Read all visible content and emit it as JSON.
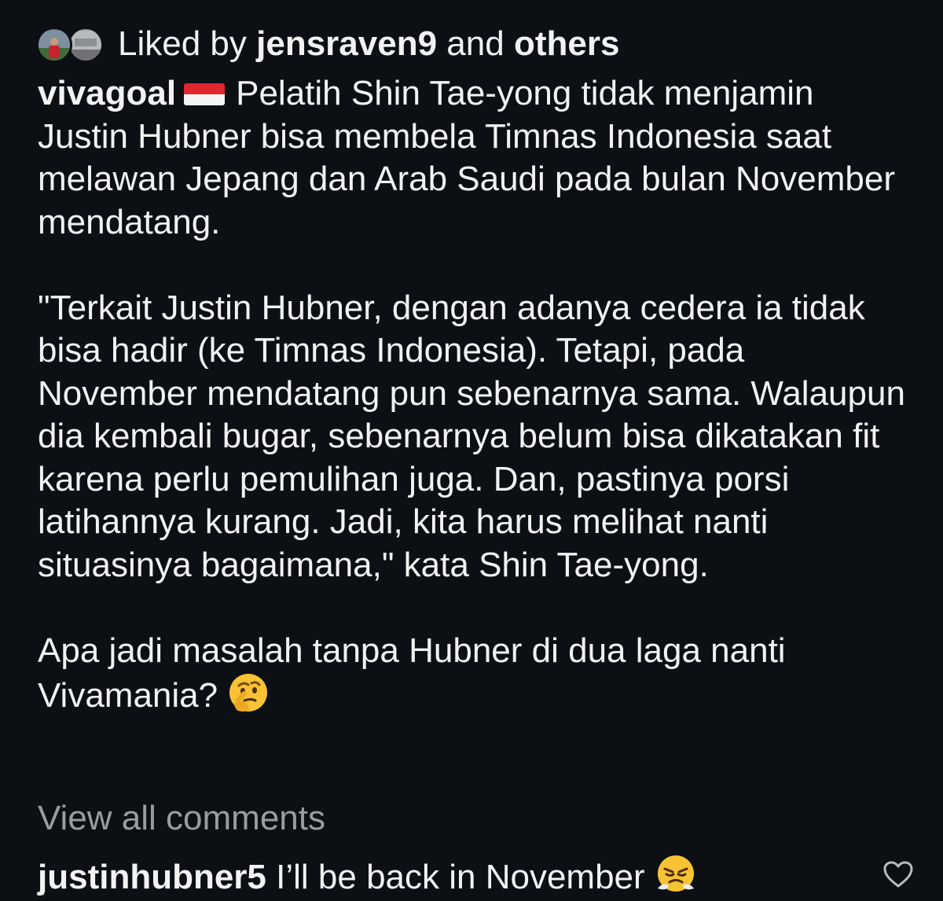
{
  "likes": {
    "prefix": "Liked by",
    "first_user": "jensraven9",
    "connector": "and",
    "others": "others"
  },
  "post": {
    "username": "vivagoal",
    "flag_icon": "indonesia-flag-emoji",
    "first_paragraph_text": "Pelatih Shin Tae-yong tidak menjamin Justin Hubner bisa membela Timnas Indonesia saat melawan Jepang dan Arab Saudi pada bulan November mendatang.",
    "quote_paragraph": "\"Terkait Justin Hubner, dengan adanya cedera ia tidak bisa hadir (ke Timnas Indonesia). Tetapi, pada November mendatang pun sebenarnya sama. Walaupun dia kembali bugar, sebenarnya belum bisa dikatakan fit karena perlu pemulihan juga. Dan, pastinya porsi latihannya kurang. Jadi, kita harus melihat nanti situasinya bagaimana,\" kata Shin Tae-yong.",
    "question_text": "Apa jadi masalah tanpa Hubner di dua laga nanti Vivamania?",
    "question_emoji_icon": "thinking-face-emoji"
  },
  "view_all_comments_label": "View all comments",
  "comment": {
    "username": "justinhubner5",
    "text": "I’ll be back in November",
    "emoji_icon": "face-with-steam-emoji",
    "like_icon": "heart-outline-icon"
  },
  "colors": {
    "background": "#0c1015",
    "text": "#f2f2f2",
    "muted_text": "#9a9ca0"
  }
}
